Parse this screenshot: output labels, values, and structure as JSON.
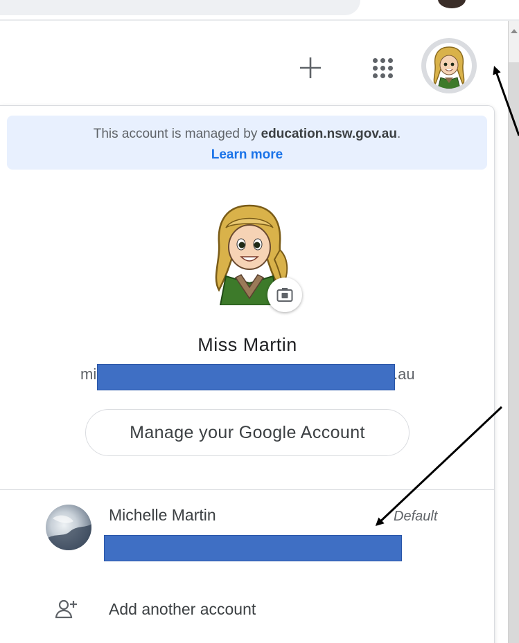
{
  "header": {
    "add_icon": "plus-icon",
    "apps_icon": "apps-grid-icon",
    "account_icon": "profile-avatar"
  },
  "banner": {
    "prefix": "This account is managed by ",
    "domain": "education.nsw.gov.au",
    "suffix": ".",
    "learn_more": "Learn more",
    "background": "#e8f0fe",
    "link_color": "#1a73e8"
  },
  "profile": {
    "display_name": "Miss Martin",
    "email_prefix": "mic",
    "email_suffix": ".au",
    "camera_icon": "camera-icon"
  },
  "manage_button": {
    "label": "Manage your Google Account"
  },
  "accounts": [
    {
      "name": "Michelle Martin",
      "badge": "Default"
    }
  ],
  "add_account": {
    "label": "Add another account",
    "icon": "person-add-icon"
  },
  "colors": {
    "redaction": "#3f6fc4",
    "text_primary": "#3c4043",
    "text_secondary": "#5f6368"
  }
}
